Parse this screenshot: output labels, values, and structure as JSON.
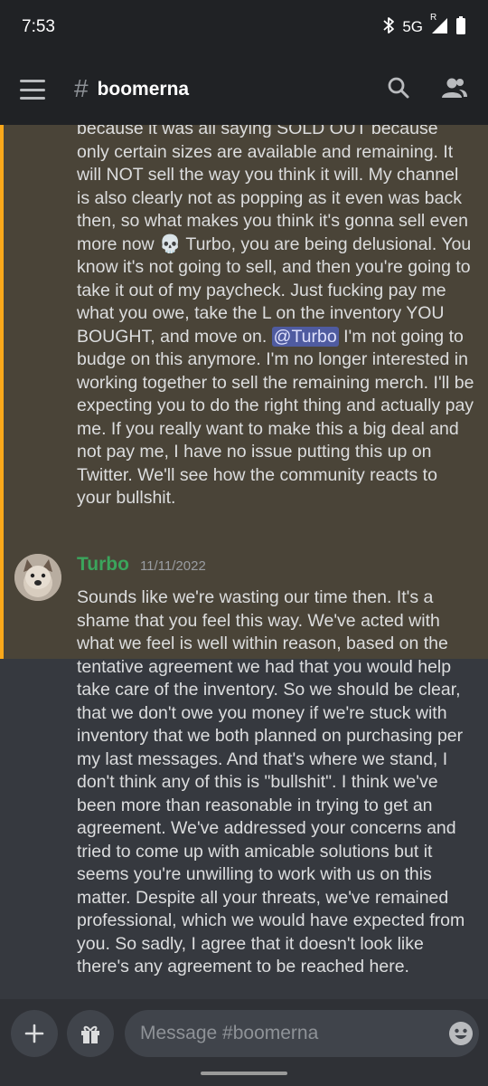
{
  "status_bar": {
    "time": "7:53",
    "network": "5G",
    "roaming": "R"
  },
  "header": {
    "channel_name": "boomerna"
  },
  "messages": [
    {
      "author": "",
      "highlighted": true,
      "text_before_mention": "because it was all saying SOLD OUT because only certain sizes are available and remaining. It will NOT sell the way you think it will. My channel is also clearly not as popping as it even was back then, so what makes you think it's gonna sell even more now 💀 Turbo, you are being delusional. You know it's not going to sell, and then you're going to take it out of my paycheck. Just fucking pay me what you owe, take the L on the inventory YOU BOUGHT, and move on. ",
      "mention": "@Turbo",
      "text_after_mention": " I'm not going to budge on this anymore. I'm no longer interested in working together to sell the remaining merch. I'll be expecting you to do the right thing and actually pay me. If you really want to make this a big deal and not pay me, I have no issue putting this up on Twitter. We'll see how the community reacts to your bullshit."
    },
    {
      "author": "Turbo",
      "author_color": "#3ba55c",
      "timestamp": "11/11/2022",
      "text": "Sounds like we're wasting our time then. It's a shame that you feel this way. We've acted with what we feel is well within reason, based on the tentative agreement we had that you would help take care of the inventory. So we should be clear, that we don't owe you money if we're stuck with inventory that we both planned on purchasing per my last messages. And that's where we stand, I don't think any of this is \"bullshit\". I think we've been more than reasonable in trying to get an agreement. We've addressed your concerns and tried to come up with amicable solutions but it seems you're unwilling to work with us on this matter. Despite all your threats, we've remained professional, which we would have expected from you. So sadly, I agree that it doesn't look like there's any agreement to be reached here."
    }
  ],
  "composer": {
    "placeholder": "Message #boomerna"
  },
  "colors": {
    "mention_highlight": "#faa81a",
    "background": "#36393f",
    "bars": "#202225"
  }
}
